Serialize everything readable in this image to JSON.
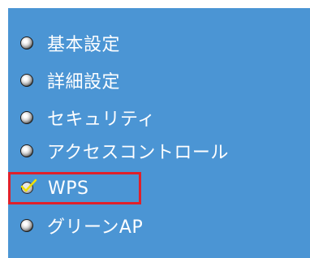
{
  "menu": {
    "items": [
      {
        "label": "基本設定",
        "state": "normal",
        "icon": "radio-bullet-icon"
      },
      {
        "label": "詳細設定",
        "state": "normal",
        "icon": "radio-bullet-icon"
      },
      {
        "label": "セキュリティ",
        "state": "normal",
        "icon": "radio-bullet-icon"
      },
      {
        "label": "アクセスコントロール",
        "state": "normal",
        "icon": "radio-bullet-icon"
      },
      {
        "label": "WPS",
        "state": "selected",
        "icon": "check-bullet-icon"
      },
      {
        "label": "グリーンAP",
        "state": "normal",
        "icon": "radio-bullet-icon"
      }
    ]
  },
  "colors": {
    "panel_background": "#4b95d4",
    "text": "#ffffff",
    "highlight_border": "#e0202a",
    "check_mark": "#f0e000"
  }
}
